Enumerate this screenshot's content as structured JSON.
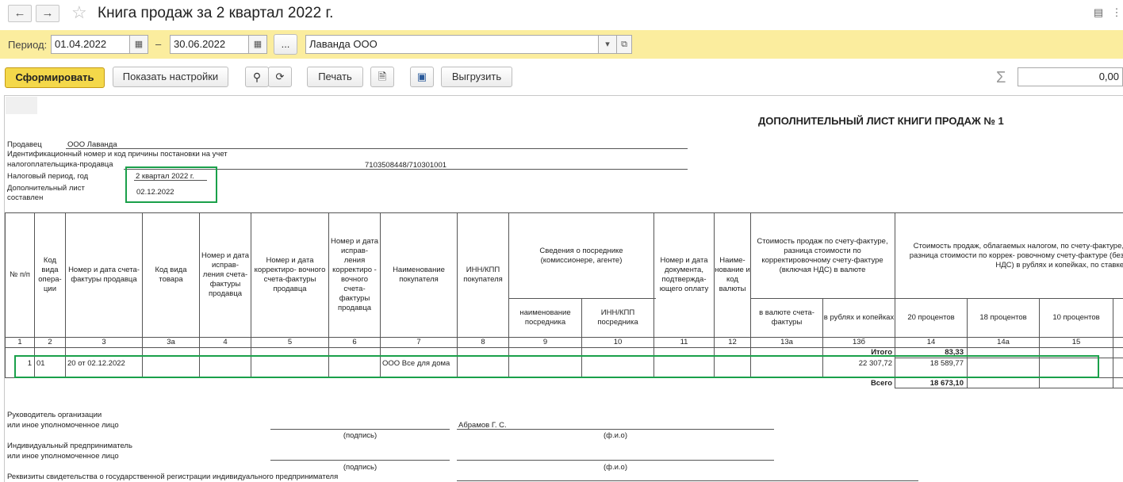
{
  "window": {
    "title": "Книга продаж за 2 квартал 2022 г."
  },
  "filter": {
    "period_label": "Период:",
    "date_from": "01.04.2022",
    "dash": "–",
    "date_to": "30.06.2022",
    "more": "...",
    "org": "Лаванда ООО"
  },
  "toolbar": {
    "generate": "Сформировать",
    "settings": "Показать настройки",
    "print": "Печать",
    "export": "Выгрузить",
    "sum_value": "0,00"
  },
  "doc": {
    "heading": "ДОПОЛНИТЕЛЬНЫЙ ЛИСТ КНИГИ ПРОДАЖ № 1",
    "seller_label": "Продавец",
    "seller_value": "ООО Лаванда",
    "inn_label1": "Идентификационный номер и код причины постановки на учет",
    "inn_label2": "налогоплательщика-продавца",
    "inn_value": "7103508448/710301001",
    "period_label": "Налоговый период, год",
    "period_value": "2 квартал 2022 г.",
    "addsheet_label1": "Дополнительный лист",
    "addsheet_label2": "составлен",
    "addsheet_value": "02.12.2022"
  },
  "table": {
    "headers": {
      "h1": "№ п/п",
      "h2": "Код вида опера- ции",
      "h3": "Номер и дата счета-фактуры продавца",
      "h3a": "Код вида товара",
      "h4": "Номер и дата исправ- ления счета- фактуры продавца",
      "h5": "Номер и дата корректиро- вочного счета-фактуры продавца",
      "h6": "Номер и дата исправ- ления корректиро - вочного счета- фактуры продавца",
      "h7": "Наименование покупателя",
      "h8": "ИНН/КПП покупателя",
      "h9_group": "Сведения о посреднике (комиссионере, агенте)",
      "h9": "наименование посредника",
      "h10": "ИНН/КПП посредника",
      "h11": "Номер и дата документа, подтвержда- ющего оплату",
      "h12": "Наиме- нование и код валюты",
      "h13_group": "Стоимость продаж по счету-фактуре, разница стоимости по корректировочному счету-фактуре (включая НДС) в валюте",
      "h13a": "в валюте счета-фактуры",
      "h13b": "в рублях и копейках",
      "h14_group": "Стоимость продаж, облагаемых налогом, по счету-фактуре, разница стоимости по коррек- ровочному счету-фактуре (без НДС) в рублях и копейках, по ставке",
      "h14": "20 процентов",
      "h14a": "18 процентов",
      "h15": "10 процентов"
    },
    "col_numbers": [
      "1",
      "2",
      "3",
      "3а",
      "4",
      "5",
      "6",
      "7",
      "8",
      "9",
      "10",
      "11",
      "12",
      "13а",
      "13б",
      "14",
      "14а",
      "15"
    ],
    "itogo_label": "Итого",
    "itogo_value": "83,33",
    "row": {
      "n": "1",
      "code": "01",
      "invoice": "20 от 02.12.2022",
      "buyer": "ООО Все для дома",
      "sum_rub": "22 307,72",
      "sum20": "18 589,77"
    },
    "vsego_label": "Всего",
    "vsego_value": "18 673,10"
  },
  "signs": {
    "head_label1": "Руководитель организации",
    "head_label2": "или иное уполномоченное лицо",
    "sign_caption": "(подпись)",
    "head_name": "Абрамов Г. С.",
    "fio_caption": "(ф.и.о)",
    "ip_label1": "Индивидуальный предприниматель",
    "ip_label2": "или иное уполномоченное лицо",
    "req_label": "Реквизиты свидетельства о государственной регистрации индивидуального предпринимателя"
  }
}
